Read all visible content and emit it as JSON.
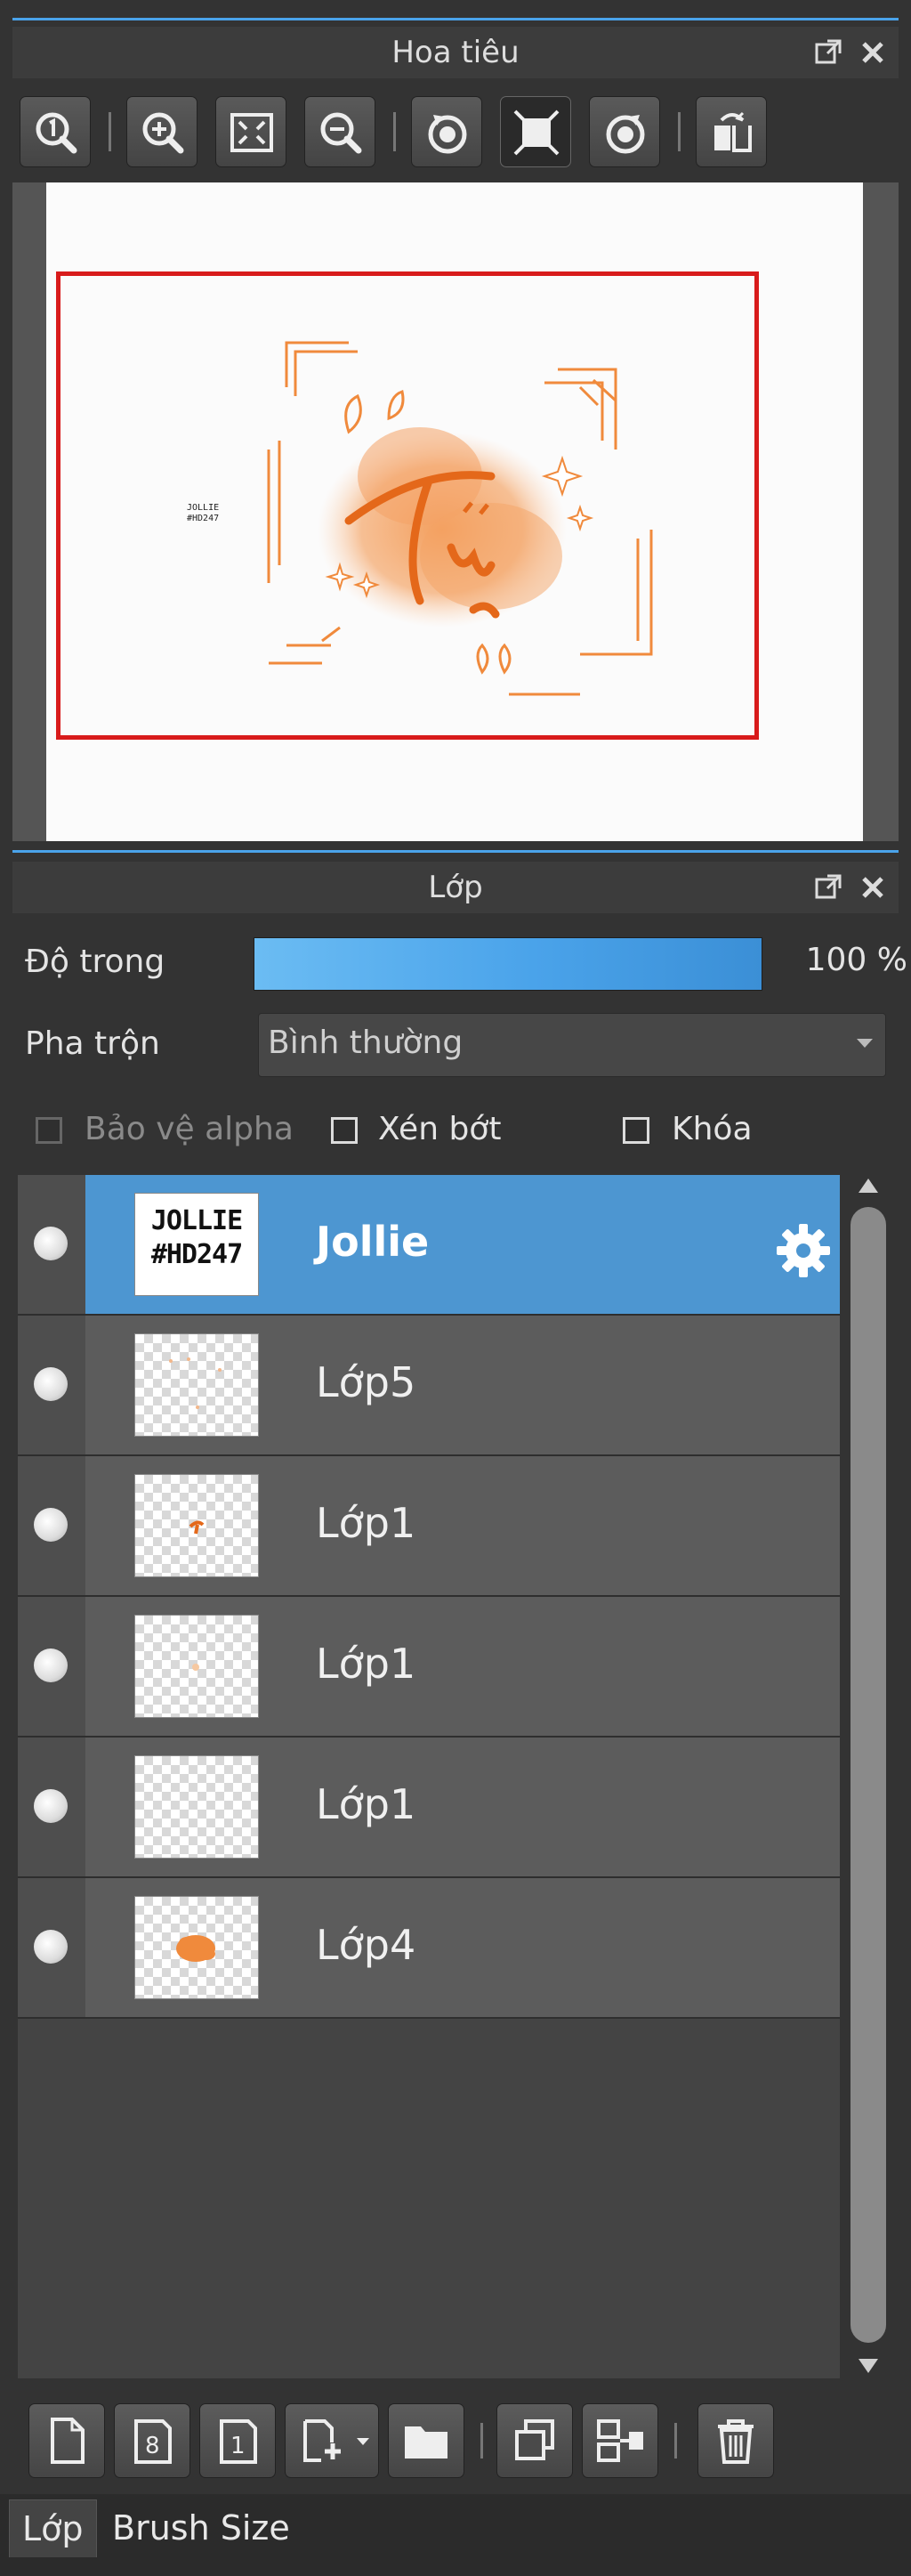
{
  "navigator": {
    "title": "Hoa tiêu",
    "toolbar": [
      {
        "icon": "zoom-actual-size-icon"
      },
      {
        "icon": "zoom-in-icon"
      },
      {
        "icon": "fit-to-window-icon"
      },
      {
        "icon": "zoom-out-icon"
      },
      {
        "icon": "rotate-left-icon"
      },
      {
        "icon": "reset-view-icon"
      },
      {
        "icon": "rotate-right-icon"
      },
      {
        "icon": "flip-horizontal-icon"
      }
    ],
    "preview": {
      "text": "JOLLIE #HD247"
    }
  },
  "layers": {
    "title": "Lớp",
    "opacity_label": "Độ trong",
    "opacity_value": "100 %",
    "opacity_fraction": 1.0,
    "blend_label": "Pha trộn",
    "blend_value": "Bình thường",
    "protect_alpha": "Bảo vệ alpha",
    "clipping": "Xén bớt",
    "lock": "Khóa",
    "items": [
      {
        "name": "Jollie",
        "thumb_text": "JOLLIE\n#HD247",
        "selected": true
      },
      {
        "name": "Lớp5",
        "selected": false
      },
      {
        "name": "Lớp1",
        "selected": false
      },
      {
        "name": "Lớp1",
        "selected": false
      },
      {
        "name": "Lớp1",
        "selected": false
      },
      {
        "name": "Lớp4",
        "selected": false
      }
    ]
  },
  "tabs": [
    "Lớp",
    "Brush Size"
  ],
  "colors": {
    "accent": "#4aa3ea",
    "selected_row": "#4d96d1",
    "viewport_frame": "#d81b1b",
    "art_orange": "#f08a3c"
  }
}
